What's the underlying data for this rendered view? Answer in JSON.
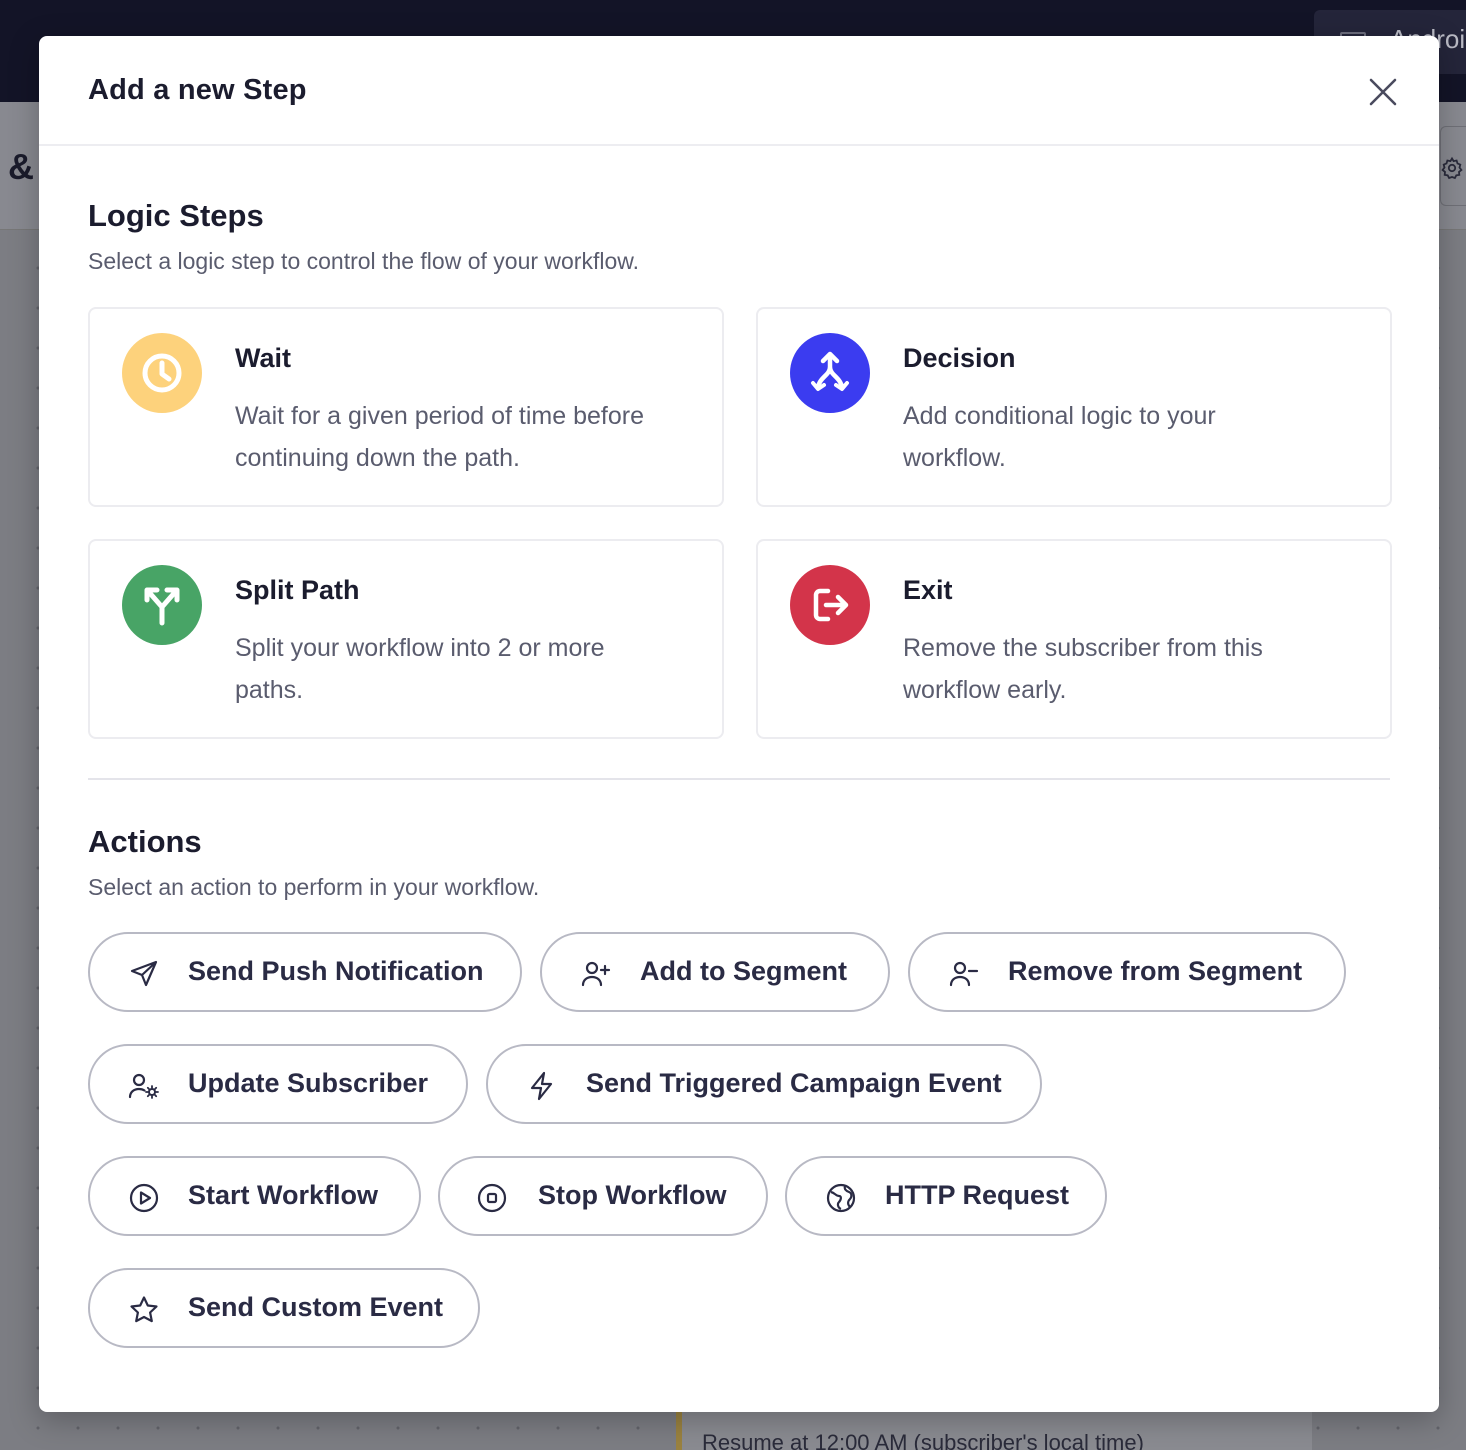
{
  "background": {
    "top_button_text": "Androi",
    "ampersand": "&",
    "node_text": "Resume at 12:00 AM (subscriber's local time)"
  },
  "modal": {
    "title": "Add a new Step"
  },
  "logic_steps": {
    "title": "Logic Steps",
    "subtitle": "Select a logic step to control the flow of your workflow.",
    "cards": [
      {
        "title": "Wait",
        "description": "Wait for a given period of time before continuing down the path.",
        "icon": "clock-icon",
        "color": "#fdd27c"
      },
      {
        "title": "Decision",
        "description": "Add conditional logic to your workflow.",
        "icon": "branch-merge-icon",
        "color": "#3b3cf0"
      },
      {
        "title": "Split Path",
        "description": "Split your workflow into 2 or more paths.",
        "icon": "split-icon",
        "color": "#48a466"
      },
      {
        "title": "Exit",
        "description": "Remove the subscriber from this workflow early.",
        "icon": "exit-icon",
        "color": "#d3344a"
      }
    ]
  },
  "actions": {
    "title": "Actions",
    "subtitle": "Select an action to perform in your workflow.",
    "buttons": [
      {
        "label": "Send Push Notification",
        "icon": "paper-plane-icon"
      },
      {
        "label": "Add to Segment",
        "icon": "user-plus-icon"
      },
      {
        "label": "Remove from Segment",
        "icon": "user-minus-icon"
      },
      {
        "label": "Update Subscriber",
        "icon": "user-gear-icon"
      },
      {
        "label": "Send Triggered Campaign Event",
        "icon": "lightning-icon"
      },
      {
        "label": "Start Workflow",
        "icon": "play-circle-icon"
      },
      {
        "label": "Stop Workflow",
        "icon": "stop-circle-icon"
      },
      {
        "label": "HTTP Request",
        "icon": "globe-icon"
      },
      {
        "label": "Send Custom Event",
        "icon": "star-icon"
      }
    ]
  }
}
